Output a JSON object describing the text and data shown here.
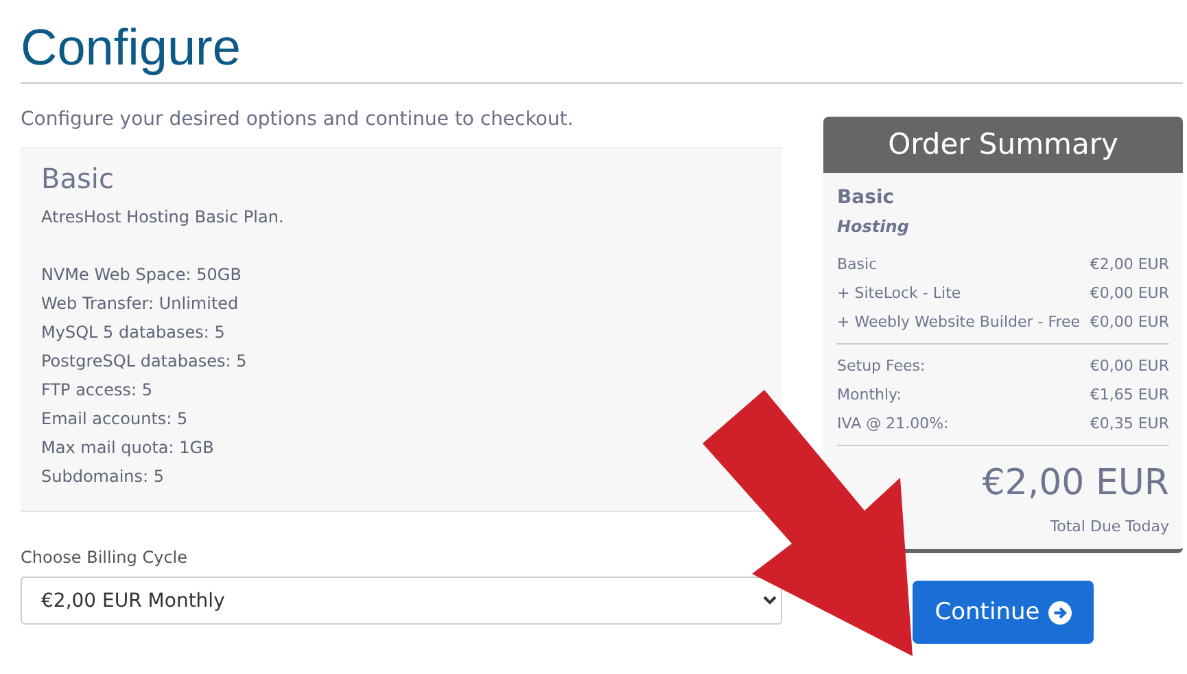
{
  "title": "Configure",
  "intro": "Configure your desired options and continue to checkout.",
  "product": {
    "name": "Basic",
    "description": "AtresHost Hosting Basic Plan.",
    "features": [
      "NVMe Web Space: 50GB",
      "Web Transfer: Unlimited",
      "MySQL 5 databases: 5",
      "PostgreSQL databases: 5",
      "FTP access: 5",
      "Email accounts: 5",
      "Max mail quota: 1GB",
      "Subdomains: 5"
    ]
  },
  "billing": {
    "label": "Choose Billing Cycle",
    "value": "€2,00 EUR Monthly"
  },
  "summary": {
    "title": "Order Summary",
    "product": "Basic",
    "group": "Hosting",
    "items": [
      {
        "label": "Basic",
        "amount": "€2,00 EUR"
      },
      {
        "label": "+ SiteLock - Lite",
        "amount": "€0,00 EUR"
      },
      {
        "label": "+ Weebly Website Builder - Free",
        "amount": "€0,00 EUR"
      }
    ],
    "fees": [
      {
        "label": "Setup Fees:",
        "amount": "€0,00 EUR"
      },
      {
        "label": "Monthly:",
        "amount": "€1,65 EUR"
      },
      {
        "label": "IVA @ 21.00%:",
        "amount": "€0,35 EUR"
      }
    ],
    "total": "€2,00 EUR",
    "total_label": "Total Due Today"
  },
  "continue_button": "Continue"
}
